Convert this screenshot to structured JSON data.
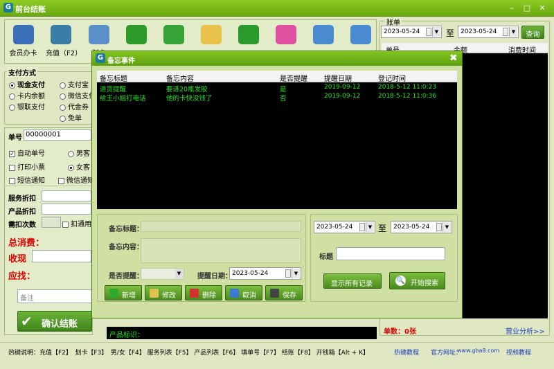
{
  "app": {
    "title": "前台结账"
  },
  "toolbar": [
    {
      "label": "会员办卡",
      "icon": "member-card-icon",
      "color": "#3b6fb8"
    },
    {
      "label": "充值（F2）",
      "icon": "money-bag-icon",
      "color": "#3a7ea8"
    },
    {
      "label": "划卡",
      "icon": "card-swipe-icon",
      "color": "#5a8fc8"
    },
    {
      "label": "",
      "icon": "refresh-icon",
      "color": "#2e9a2a"
    },
    {
      "label": "",
      "icon": "star-icon",
      "color": "#36a336"
    },
    {
      "label": "",
      "icon": "note-icon",
      "color": "#e8c24a"
    },
    {
      "label": "",
      "icon": "phone-icon",
      "color": "#2a9a2a"
    },
    {
      "label": "",
      "icon": "gift-icon",
      "color": "#e050a0"
    },
    {
      "label": "",
      "icon": "upload-icon",
      "color": "#4a8ad0"
    },
    {
      "label": "",
      "icon": "download-icon",
      "color": "#4a8ad0"
    }
  ],
  "payment": {
    "title": "支付方式",
    "options": [
      {
        "label": "现金支付",
        "on": true
      },
      {
        "label": "支付宝",
        "on": false
      },
      {
        "label": "卡内余额",
        "on": false
      },
      {
        "label": "微信支付",
        "on": false
      },
      {
        "label": "银联支付",
        "on": false
      },
      {
        "label": "代金券",
        "on": false
      },
      {
        "label": "",
        "on": false
      },
      {
        "label": "免单",
        "on": false
      }
    ]
  },
  "left": {
    "card_no_label": "单号",
    "card_no": "00000001",
    "auto_no": "自动单号",
    "male": "男客",
    "print_ticket": "打印小票",
    "female": "女客",
    "sms": "短信通知",
    "wechat": "微信通知",
    "service_discount": "服务折扣",
    "product_discount": "产品折扣",
    "deduct_times": "需扣次数",
    "deduct_flag": "扣通用",
    "total_label": "总消费：",
    "receive_label": "收现",
    "change_label": "应找：",
    "remark_placeholder": "备注",
    "confirm_btn": "确认结账"
  },
  "bill": {
    "title": "账单",
    "date_from": "2023-05-24",
    "to": "至",
    "date_to": "2023-05-24",
    "query_btn": "查询",
    "col_no": "单号",
    "col_amount": "金额",
    "col_time": "消费时间",
    "count_label": "单数：0张",
    "analysis_link": "营业分析>>"
  },
  "product_label": "产品标识：",
  "modal": {
    "title": "备忘事件",
    "columns": [
      "备忘标题",
      "备忘内容",
      "是否提醒",
      "提醒日期",
      "登记时间"
    ],
    "rows": [
      [
        "进货提醒",
        "要进20瓶发胶",
        "是",
        "2019-09-12",
        "2018-5-12 11:0:23"
      ],
      [
        "给王小姐打电话",
        "他的卡快没钱了",
        "否",
        "2019-09-12",
        "2018-5-12 11:0:36"
      ]
    ],
    "form": {
      "title_label": "备忘标题：",
      "content_label": "备忘内容：",
      "remind_label": "是否提醒：",
      "remind_date_label": "提醒日期：",
      "remind_date": "2023-05-24"
    },
    "buttons": {
      "add": "新增",
      "edit": "修改",
      "delete": "删除",
      "cancel": "取消",
      "save": "保存"
    },
    "search": {
      "date_from": "2023-05-24",
      "to": "至",
      "date_to": "2023-05-24",
      "title_label": "标题",
      "show_all": "显示所有记录",
      "start_search": "开始搜索"
    }
  },
  "status": {
    "hint": "热键说明：充值【F2】　划卡【F3】　男/女【F4】 服务列表【F5】 产品列表【F6】 填单号【F7】 结账【F8】 开钱箱【Alt + K】",
    "tutorial": "热键教程",
    "site_label": "官方网址：",
    "site": "www.gba8.com",
    "video": "视频教程"
  }
}
